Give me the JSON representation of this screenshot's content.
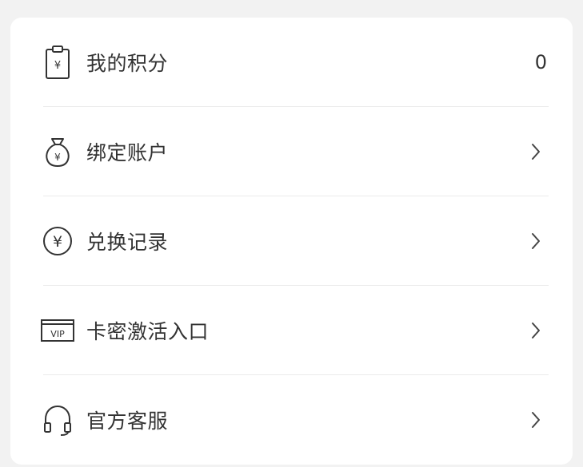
{
  "menu": {
    "items": [
      {
        "label": "我的积分",
        "value": "0",
        "icon": "points-clipboard-icon"
      },
      {
        "label": "绑定账户",
        "icon": "money-bag-icon"
      },
      {
        "label": "兑换记录",
        "icon": "yuan-circle-icon"
      },
      {
        "label": "卡密激活入口",
        "icon": "vip-card-icon",
        "icon_text": "VIP"
      },
      {
        "label": "官方客服",
        "icon": "headset-icon"
      }
    ]
  },
  "colors": {
    "background": "#f2f2f2",
    "card": "#ffffff",
    "text": "#333333",
    "divider": "#ebebeb"
  }
}
